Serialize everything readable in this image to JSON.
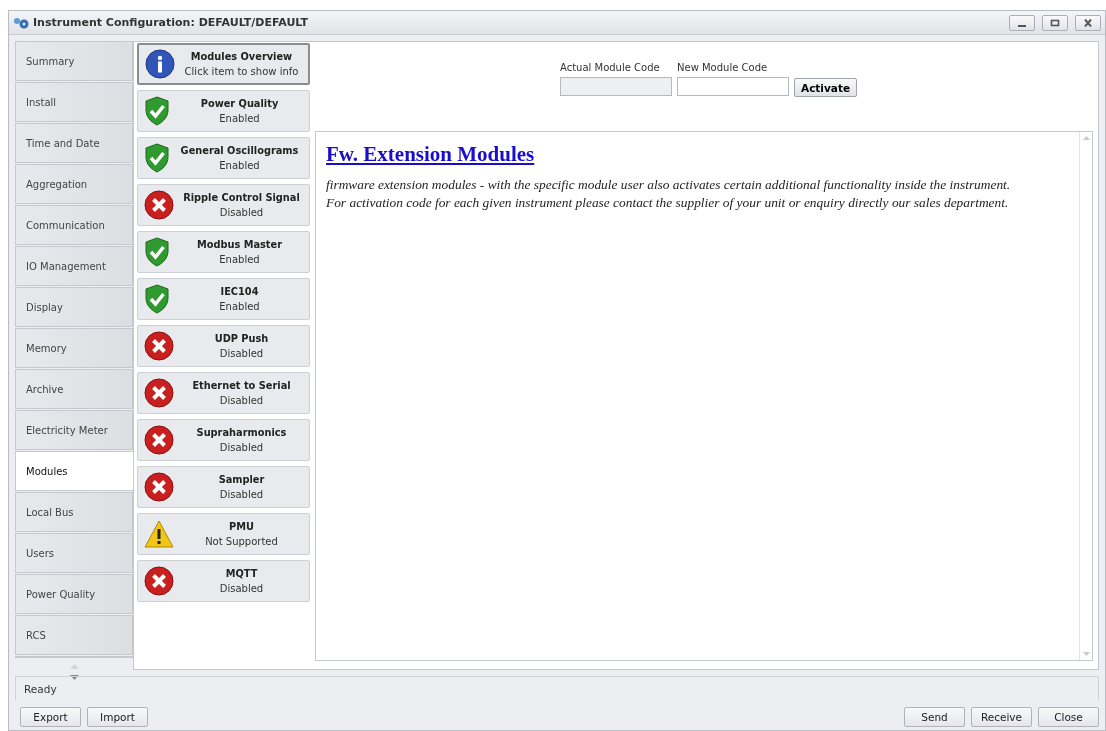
{
  "window": {
    "title": "Instrument Configuration: DEFAULT/DEFAULT"
  },
  "nav": [
    {
      "label": "Summary",
      "selected": false
    },
    {
      "label": "Install",
      "selected": false
    },
    {
      "label": "Time and Date",
      "selected": false
    },
    {
      "label": "Aggregation",
      "selected": false
    },
    {
      "label": "Communication",
      "selected": false
    },
    {
      "label": "IO Management",
      "selected": false
    },
    {
      "label": "Display",
      "selected": false
    },
    {
      "label": "Memory",
      "selected": false
    },
    {
      "label": "Archive",
      "selected": false
    },
    {
      "label": "Electricity Meter",
      "selected": false
    },
    {
      "label": "Modules",
      "selected": true
    },
    {
      "label": "Local Bus",
      "selected": false
    },
    {
      "label": "Users",
      "selected": false
    },
    {
      "label": "Power Quality",
      "selected": false
    },
    {
      "label": "RCS",
      "selected": false
    }
  ],
  "modules": [
    {
      "kind": "info",
      "name": "Modules Overview",
      "status": "Click item to show info",
      "selected": true
    },
    {
      "kind": "enabled",
      "name": "Power Quality",
      "status": "Enabled",
      "selected": false
    },
    {
      "kind": "enabled",
      "name": "General Oscillograms",
      "status": "Enabled",
      "selected": false
    },
    {
      "kind": "disabled",
      "name": "Ripple Control Signal",
      "status": "Disabled",
      "selected": false
    },
    {
      "kind": "enabled",
      "name": "Modbus Master",
      "status": "Enabled",
      "selected": false
    },
    {
      "kind": "enabled",
      "name": "IEC104",
      "status": "Enabled",
      "selected": false
    },
    {
      "kind": "disabled",
      "name": "UDP Push",
      "status": "Disabled",
      "selected": false
    },
    {
      "kind": "disabled",
      "name": "Ethernet to Serial",
      "status": "Disabled",
      "selected": false
    },
    {
      "kind": "disabled",
      "name": "Supraharmonics",
      "status": "Disabled",
      "selected": false
    },
    {
      "kind": "disabled",
      "name": "Sampler",
      "status": "Disabled",
      "selected": false
    },
    {
      "kind": "unsupported",
      "name": "PMU",
      "status": "Not Supported",
      "selected": false
    },
    {
      "kind": "disabled",
      "name": "MQTT",
      "status": "Disabled",
      "selected": false
    }
  ],
  "code_form": {
    "actual_label": "Actual Module Code",
    "new_label": "New Module Code",
    "activate_button": "Activate"
  },
  "info": {
    "heading": "Fw. Extension Modules",
    "body": "firmware extension modules - with the specific module user also activates certain additional functionality inside the instrument.\nFor activation code for each given instrument please contact the supplier of your unit or enquiry directly our sales department."
  },
  "status_bar": {
    "text": "Ready"
  },
  "left_buttons": [
    "Export",
    "Import"
  ],
  "right_buttons": [
    "Send",
    "Receive",
    "Close"
  ]
}
